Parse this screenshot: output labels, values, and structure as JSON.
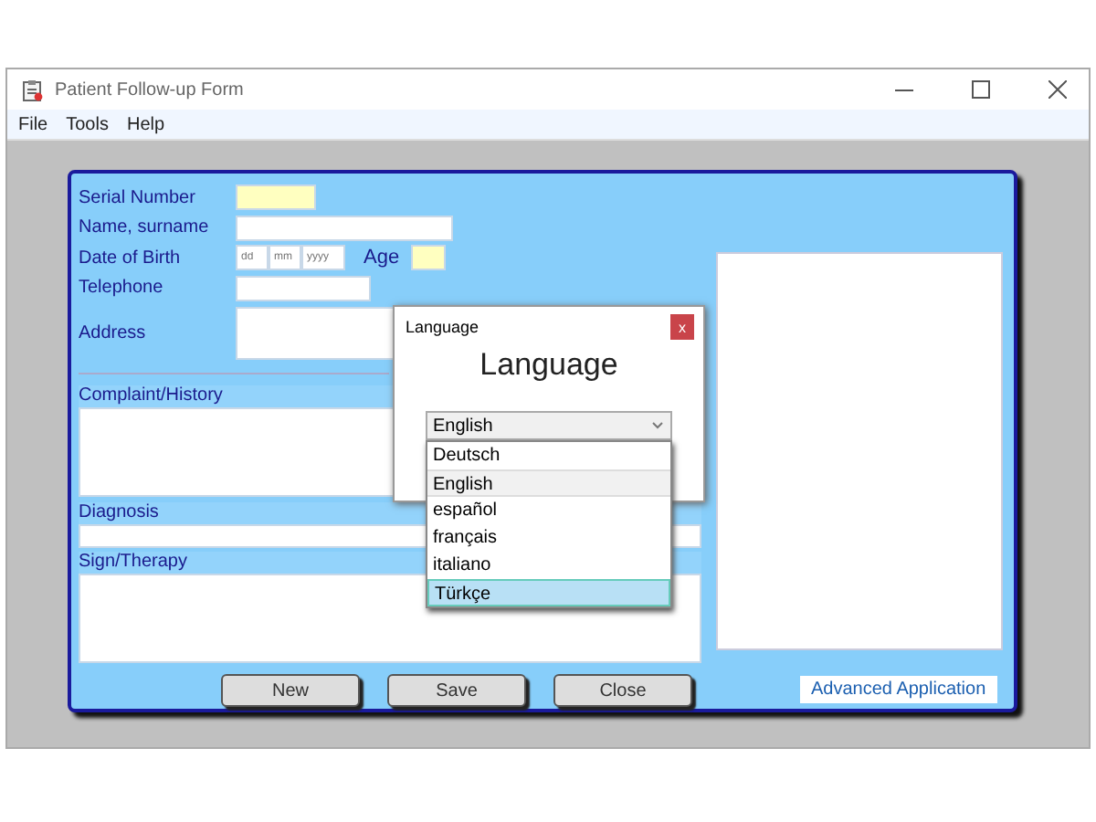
{
  "window": {
    "title": "Patient Follow-up Form"
  },
  "menu": [
    "File",
    "Tools",
    "Help"
  ],
  "fields": [
    {
      "label": "Serial Number",
      "kind": "code"
    },
    {
      "label": "Name, surname",
      "kind": "name"
    },
    {
      "label": "Date of Birth",
      "kind": "date",
      "placeholders": [
        "dd",
        "mm",
        "yyyy"
      ],
      "age_label": "Age"
    },
    {
      "label": "Telephone",
      "kind": "phone"
    },
    {
      "label": "Address",
      "kind": "address"
    }
  ],
  "sections": [
    {
      "label": "Complaint/History",
      "kind": "area"
    },
    {
      "label": "Diagnosis",
      "kind": "line"
    },
    {
      "label": "Sign/Therapy",
      "kind": "area"
    }
  ],
  "buttons": [
    "New",
    "Save",
    "Close"
  ],
  "link": "Advanced Application",
  "dialog": {
    "title": "Language",
    "heading": "Language",
    "close": "x",
    "value": "English",
    "options": [
      {
        "label": "Deutsch",
        "selected": false,
        "highlighted": false
      },
      {
        "label": "English",
        "selected": true,
        "highlighted": false
      },
      {
        "label": "español",
        "selected": false,
        "highlighted": false
      },
      {
        "label": "français",
        "selected": false,
        "highlighted": false
      },
      {
        "label": "italiano",
        "selected": false,
        "highlighted": false
      },
      {
        "label": "Türkçe",
        "selected": false,
        "highlighted": true
      }
    ]
  }
}
